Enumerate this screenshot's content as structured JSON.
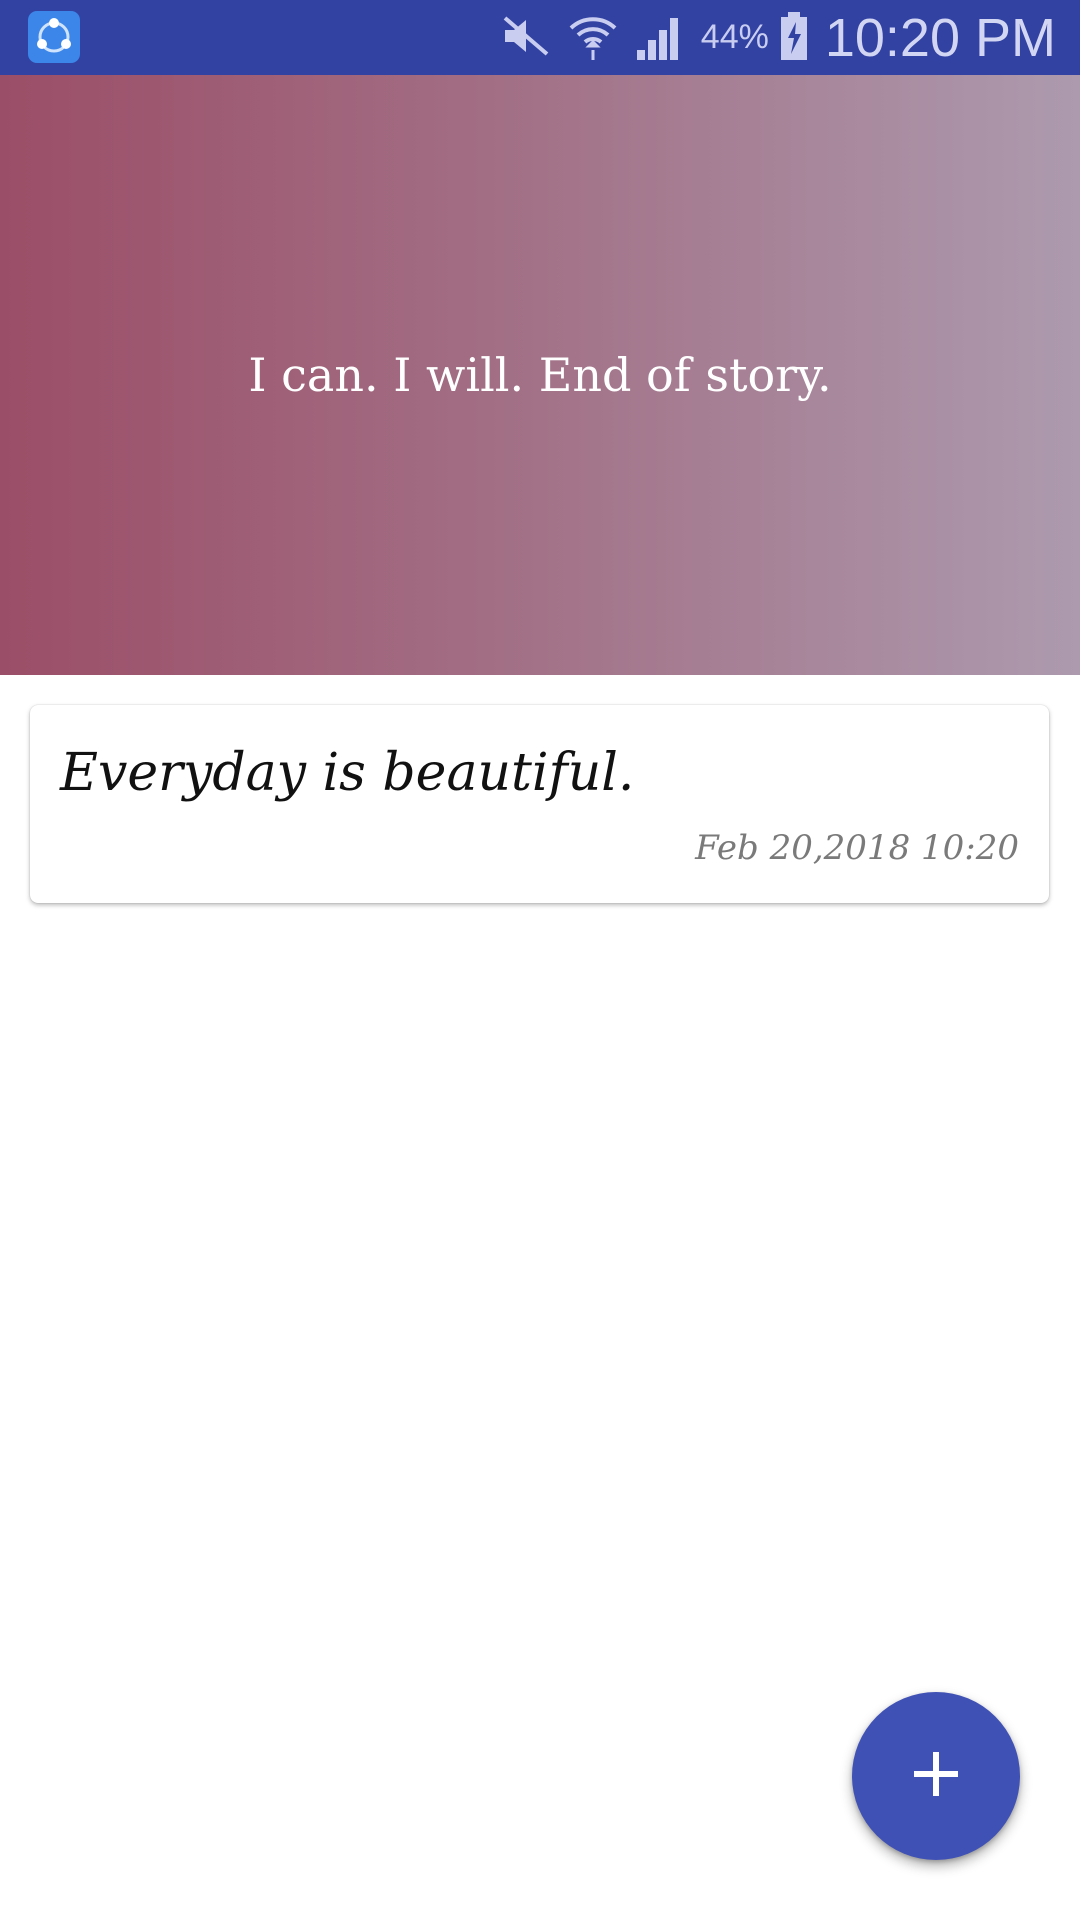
{
  "status_bar": {
    "battery_percent": "44%",
    "time": "10:20 PM",
    "icons": [
      "shareit-app-icon",
      "mute-icon",
      "wifi-icon",
      "signal-icon",
      "battery-charging-icon"
    ]
  },
  "header": {
    "quote": "I can. I will. End of story."
  },
  "notes": [
    {
      "text": "Everyday is beautiful.",
      "date": "Feb 20,2018 10:20"
    }
  ],
  "fab": {
    "icon": "plus-icon"
  },
  "colors": {
    "status_bar": "#3242a3",
    "hero_gradient_start": "#9b4e67",
    "hero_gradient_end": "#ad9aae",
    "fab": "#3f51b5"
  }
}
